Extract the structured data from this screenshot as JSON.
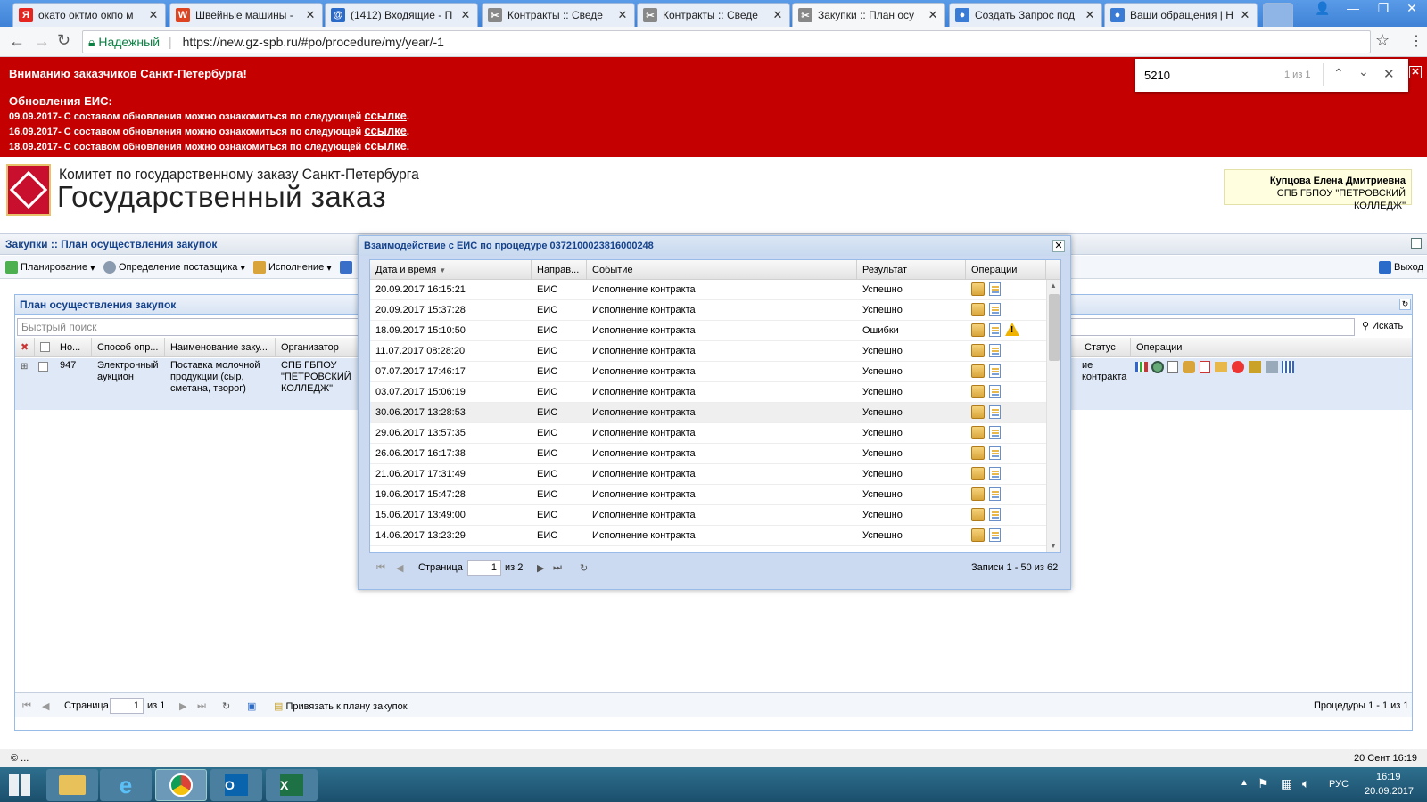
{
  "browser": {
    "tabs": [
      {
        "title": "окато октмо окпо м",
        "fav": "Я",
        "color": "#e52620"
      },
      {
        "title": "Швейные машины -",
        "fav": "W",
        "color": "#d42"
      },
      {
        "title": "(1412) Входящие - П",
        "fav": "@",
        "color": "#2a6ac9"
      },
      {
        "title": "Контракты :: Сведе",
        "fav": "✂",
        "color": "#888"
      },
      {
        "title": "Контракты :: Сведе",
        "fav": "✂",
        "color": "#888"
      },
      {
        "title": "Закупки :: План осу",
        "fav": "✂",
        "color": "#888"
      },
      {
        "title": "Создать Запрос под",
        "fav": "●",
        "color": "#3a7bd5"
      },
      {
        "title": "Ваши обращения | Н",
        "fav": "●",
        "color": "#3a7bd5"
      }
    ],
    "secure_label": "Надежный",
    "url": "https://new.gz-spb.ru/#po/procedure/my/year/-1",
    "find": {
      "query": "5210",
      "count": "1 из 1"
    }
  },
  "banner": {
    "title": "Вниманию заказчиков Санкт-Петербурга!",
    "subtitle": "Обновления ЕИС:",
    "lines": [
      {
        "date": "09.09.2017",
        "text": "- С составом обновления можно ознакомиться по следующей ",
        "link": "ссылке"
      },
      {
        "date": "16.09.2017",
        "text": "- С составом обновления можно ознакомиться по следующей ",
        "link": "ссылке"
      },
      {
        "date": "18.09.2017",
        "text": "- С составом обновления можно ознакомиться по следующей ",
        "link": "ссылке"
      }
    ]
  },
  "header": {
    "org_line": "Комитет по государственному заказу Санкт-Петербурга",
    "brand": "Государственный заказ",
    "user_name": "Купцова Елена Дмитриевна",
    "user_org": "СПБ ГБПОУ \"ПЕТРОВСКИЙ КОЛЛЕДЖ\""
  },
  "main": {
    "title": "Закупки :: План осуществления закупок",
    "menu": {
      "planning": "Планирование",
      "supplier": "Определение поставщика",
      "execution": "Исполнение",
      "exit": "Выход"
    },
    "panel_title": "План осуществления закупок",
    "search_placeholder": "Быстрый поиск",
    "search_btn": "Искать",
    "columns": {
      "no": "Но...",
      "method": "Способ опр...",
      "name": "Наименование заку...",
      "org": "Организатор",
      "status": "Статус",
      "ops": "Операции"
    },
    "row": {
      "no": "947",
      "method": "Электронный аукцион",
      "name": "Поставка молочной продукции (сыр, сметана, творог)",
      "org": "СПБ ГБПОУ \"ПЕТРОВСКИЙ КОЛЛЕДЖ\"",
      "status": "ие контракта"
    },
    "footer": {
      "page_label": "Страница",
      "page": "1",
      "of": "из 1",
      "bind": "Привязать к плану закупок",
      "summary": "Процедуры 1 - 1 из 1"
    }
  },
  "modal": {
    "title": "Взаимодействие с ЕИС по процедуре 0372100023816000248",
    "columns": {
      "dt": "Дата и время",
      "dir": "Направ...",
      "event": "Событие",
      "result": "Результат",
      "ops": "Операции"
    },
    "rows": [
      {
        "dt": "20.09.2017 16:15:21",
        "dir": "ЕИС",
        "event": "Исполнение контракта",
        "result": "Успешно",
        "warn": false
      },
      {
        "dt": "20.09.2017 15:37:28",
        "dir": "ЕИС",
        "event": "Исполнение контракта",
        "result": "Успешно",
        "warn": false
      },
      {
        "dt": "18.09.2017 15:10:50",
        "dir": "ЕИС",
        "event": "Исполнение контракта",
        "result": "Ошибки",
        "warn": true
      },
      {
        "dt": "11.07.2017 08:28:20",
        "dir": "ЕИС",
        "event": "Исполнение контракта",
        "result": "Успешно",
        "warn": false
      },
      {
        "dt": "07.07.2017 17:46:17",
        "dir": "ЕИС",
        "event": "Исполнение контракта",
        "result": "Успешно",
        "warn": false
      },
      {
        "dt": "03.07.2017 15:06:19",
        "dir": "ЕИС",
        "event": "Исполнение контракта",
        "result": "Успешно",
        "warn": false
      },
      {
        "dt": "30.06.2017 13:28:53",
        "dir": "ЕИС",
        "event": "Исполнение контракта",
        "result": "Успешно",
        "warn": false
      },
      {
        "dt": "29.06.2017 13:57:35",
        "dir": "ЕИС",
        "event": "Исполнение контракта",
        "result": "Успешно",
        "warn": false
      },
      {
        "dt": "26.06.2017 16:17:38",
        "dir": "ЕИС",
        "event": "Исполнение контракта",
        "result": "Успешно",
        "warn": false
      },
      {
        "dt": "21.06.2017 17:31:49",
        "dir": "ЕИС",
        "event": "Исполнение контракта",
        "result": "Успешно",
        "warn": false
      },
      {
        "dt": "19.06.2017 15:47:28",
        "dir": "ЕИС",
        "event": "Исполнение контракта",
        "result": "Успешно",
        "warn": false
      },
      {
        "dt": "15.06.2017 13:49:00",
        "dir": "ЕИС",
        "event": "Исполнение контракта",
        "result": "Успешно",
        "warn": false
      },
      {
        "dt": "14.06.2017 13:23:29",
        "dir": "ЕИС",
        "event": "Исполнение контракта",
        "result": "Успешно",
        "warn": false
      }
    ],
    "footer": {
      "page_label": "Страница",
      "page": "1",
      "of": "из 2",
      "summary": "Записи 1 - 50 из 62"
    }
  },
  "status": {
    "left": "© ...",
    "right": "20 Сент 16:19"
  },
  "taskbar": {
    "lang": "РУС",
    "time": "16:19",
    "date": "20.09.2017"
  }
}
